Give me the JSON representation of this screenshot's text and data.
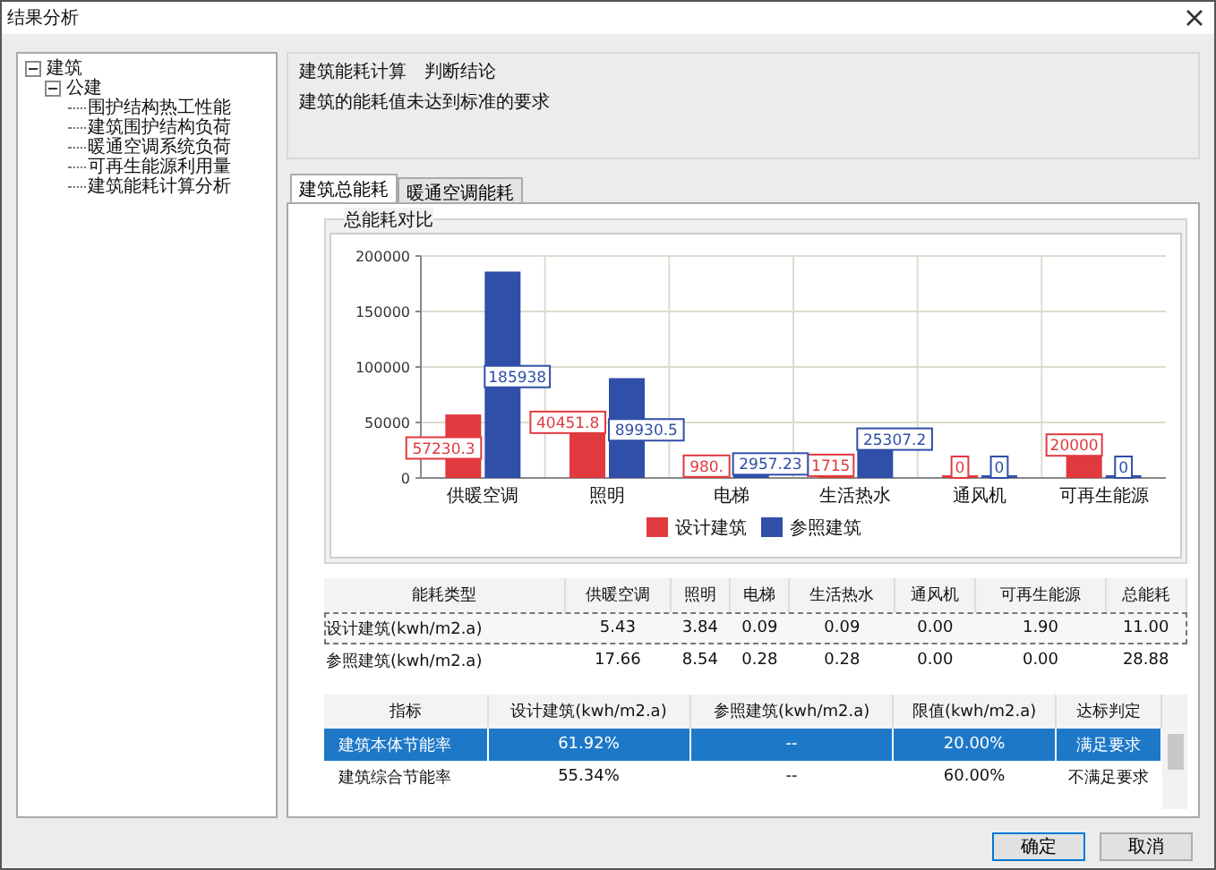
{
  "window": {
    "title": "结果分析"
  },
  "tree": [
    {
      "label": "建筑",
      "expanded": true,
      "children": [
        {
          "label": "公建",
          "expanded": true,
          "children": [
            {
              "label": "围护结构热工性能"
            },
            {
              "label": "建筑围护结构负荷"
            },
            {
              "label": "暖通空调系统负荷"
            },
            {
              "label": "可再生能源利用量"
            },
            {
              "label": "建筑能耗计算分析"
            }
          ]
        }
      ]
    }
  ],
  "conclusion": {
    "title": "建筑能耗计算　判断结论",
    "text": "建筑的能耗值未达到标准的要求"
  },
  "tabs": [
    {
      "label": "建筑总能耗",
      "selected": true
    },
    {
      "label": "暖通空调能耗",
      "selected": false
    }
  ],
  "chart_group": {
    "title": "总能耗对比",
    "chart_data": {
      "type": "bar",
      "categories": [
        "供暖空调",
        "照明",
        "电梯",
        "生活热水",
        "通风机",
        "可再生能源"
      ],
      "series": [
        {
          "name": "设计建筑",
          "color": "#e03a3e",
          "values": [
            57230.3,
            40451.8,
            980,
            1715,
            0,
            20000
          ],
          "value_labels": [
            "57230.3",
            "40451.8",
            "980.",
            "1715",
            "0",
            "20000"
          ]
        },
        {
          "name": "参照建筑",
          "color": "#2f4fa8",
          "values": [
            185938,
            89930.5,
            2957.23,
            25307.2,
            0,
            0
          ],
          "value_labels": [
            "185938",
            "89930.5",
            "2957.23",
            "25307.2",
            "0",
            "0"
          ]
        }
      ],
      "ylim": [
        0,
        200000
      ],
      "yticks": [
        0,
        50000,
        100000,
        150000,
        200000
      ],
      "data_labels": true,
      "grid": true,
      "legend": true
    }
  },
  "energy_table": {
    "columns": [
      "能耗类型",
      "供暖空调",
      "照明",
      "电梯",
      "生活热水",
      "通风机",
      "可再生能源",
      "总能耗"
    ],
    "rows": [
      {
        "focused": true,
        "cells": [
          "设计建筑(kwh/m2.a)",
          "5.43",
          "3.84",
          "0.09",
          "0.09",
          "0.00",
          "1.90",
          "11.00"
        ]
      },
      {
        "focused": false,
        "cells": [
          "参照建筑(kwh/m2.a)",
          "17.66",
          "8.54",
          "0.28",
          "0.28",
          "0.00",
          "0.00",
          "28.88"
        ]
      }
    ]
  },
  "index_table": {
    "columns": [
      "指标",
      "设计建筑(kwh/m2.a)",
      "参照建筑(kwh/m2.a)",
      "限值(kwh/m2.a)",
      "达标判定"
    ],
    "rows": [
      {
        "selected": true,
        "cells": [
          "建筑本体节能率",
          "61.92%",
          "--",
          "20.00%",
          "满足要求"
        ]
      },
      {
        "selected": false,
        "cells": [
          "建筑综合节能率",
          "55.34%",
          "--",
          "60.00%",
          "不满足要求"
        ]
      }
    ]
  },
  "buttons": [
    {
      "label": "确定",
      "default": true
    },
    {
      "label": "取消",
      "default": false
    }
  ]
}
